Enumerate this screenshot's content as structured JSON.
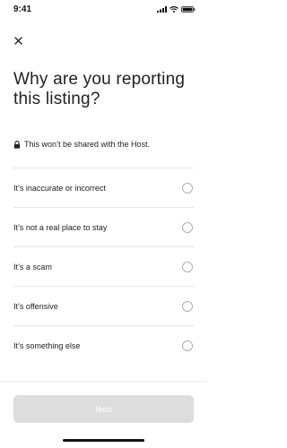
{
  "status_bar": {
    "time": "9:41",
    "icons": [
      "signal-icon",
      "wifi-icon",
      "battery-icon"
    ]
  },
  "header": {
    "close_icon": "close-icon"
  },
  "main": {
    "title": "Why are you reporting this listing?",
    "privacy_note": "This won’t be shared with the Host.",
    "privacy_icon": "lock-icon",
    "options": [
      {
        "label": "It’s inaccurate or incorrect",
        "selected": false
      },
      {
        "label": "It’s not a real place to stay",
        "selected": false
      },
      {
        "label": "It’s a scam",
        "selected": false
      },
      {
        "label": "It’s offensive",
        "selected": false
      },
      {
        "label": "It’s something else",
        "selected": false
      }
    ]
  },
  "footer": {
    "next_label": "Next",
    "next_enabled": false
  }
}
